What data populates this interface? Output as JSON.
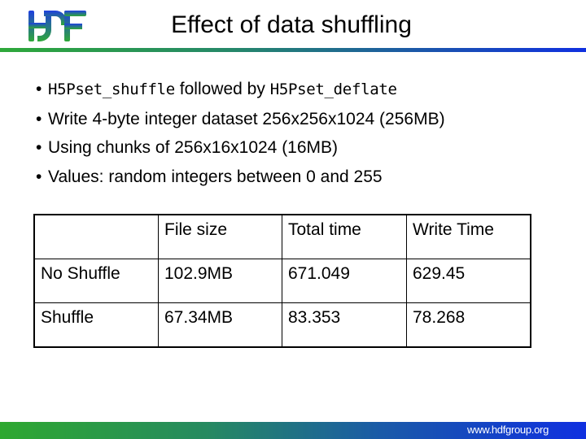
{
  "header": {
    "logo_text": "HDF",
    "title": "Effect of data shuffling"
  },
  "bullets": [
    {
      "parts": [
        {
          "text": "H5Pset_shuffle",
          "mono": true
        },
        {
          "text": " followed by ",
          "mono": false
        },
        {
          "text": "H5Pset_deflate",
          "mono": true
        }
      ]
    },
    {
      "parts": [
        {
          "text": "Write 4-byte integer dataset 256x256x1024 (256MB)",
          "mono": false
        }
      ]
    },
    {
      "parts": [
        {
          "text": "Using chunks of 256x16x1024 (16MB)",
          "mono": false
        }
      ]
    },
    {
      "parts": [
        {
          "text": "Values: random integers between 0 and 255",
          "mono": false
        }
      ]
    }
  ],
  "bullet_glyph": "•",
  "table": {
    "headers": [
      "",
      "File size",
      "Total time",
      "Write Time"
    ],
    "rows": [
      [
        "No Shuffle",
        "102.9MB",
        "671.049",
        "629.45"
      ],
      [
        "Shuffle",
        "67.34MB",
        "83.353",
        "78.268"
      ]
    ]
  },
  "footer": {
    "url": "www.hdfgroup.org"
  },
  "colors": {
    "logo_top": "#1f3fe0",
    "logo_bottom": "#2fa838",
    "accent_green": "#2ea83a",
    "accent_blue": "#1030e0"
  }
}
